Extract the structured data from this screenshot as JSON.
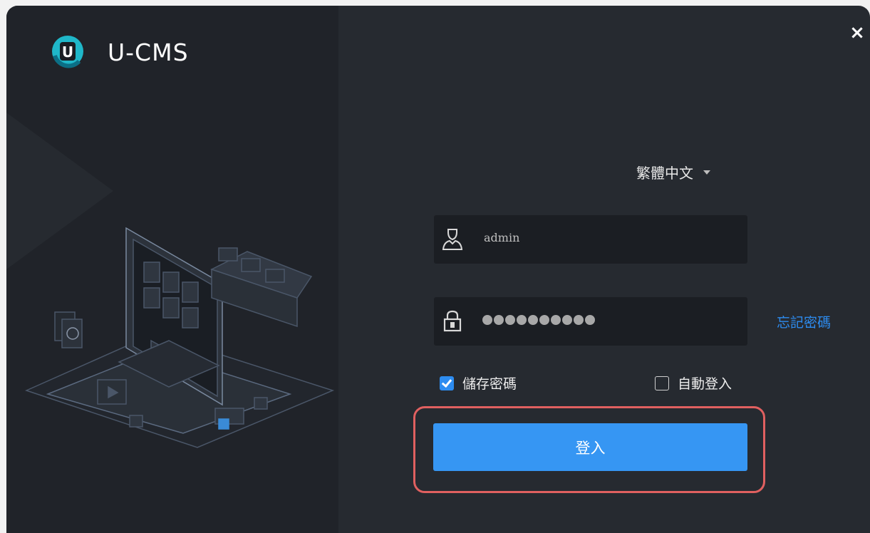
{
  "app": {
    "title": "U-CMS",
    "logo_letter": "U"
  },
  "window": {
    "close_label": "×"
  },
  "language": {
    "selected": "繁體中文"
  },
  "username": {
    "value": "admin",
    "icon": "user-icon"
  },
  "password": {
    "masked": "●●●●●●●●●●",
    "icon": "lock-icon"
  },
  "forgot_password_label": "忘記密碼",
  "remember_password": {
    "label": "儲存密碼",
    "checked": true
  },
  "auto_login": {
    "label": "自動登入",
    "checked": false
  },
  "login_button_label": "登入",
  "colors": {
    "accent": "#3696f3",
    "link": "#2d8cf0",
    "highlight": "#e06060",
    "panel_dark": "#202329",
    "panel": "#262a30"
  }
}
